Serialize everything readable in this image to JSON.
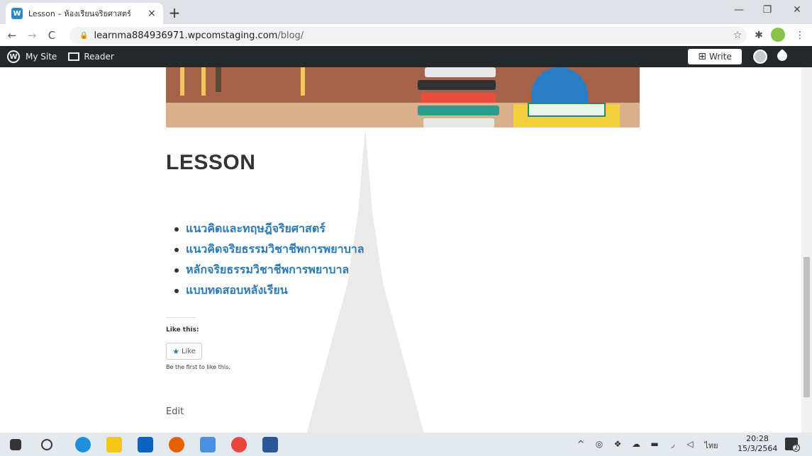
{
  "browser": {
    "tab_title": "Lesson – ห้องเรียนจริยศาสตร์",
    "favicon_letter": "W",
    "tab_close": "×",
    "new_tab": "+",
    "url_host": "learnma884936971.wpcomstaging.com",
    "url_path": "/blog/",
    "nav": {
      "back": "←",
      "forward": "→",
      "reload": "C"
    },
    "window": {
      "minimize": "—",
      "restore": "❐",
      "close": "✕"
    },
    "toolbar": {
      "bookmark": "☆",
      "extensions": "✱",
      "menu": "⋮"
    }
  },
  "wp_admin_bar": {
    "my_site": "My Site",
    "reader": "Reader",
    "write": "Write",
    "wp_logo": "W"
  },
  "post": {
    "title": "LESSON",
    "lessons": [
      "แนวคิดและทฤษฎีจริยศาสตร์",
      "แนวคิดจริยธรรมวิชาชีพการพยาบาล",
      "หลักจริยธรรมวิชาชีพการพยาบาล",
      "แบบทดสอบหลังเรียน"
    ],
    "like_heading": "Like this:",
    "like_button": "Like",
    "like_star": "★",
    "like_note": "Be the first to like this.",
    "edit_label": "Edit"
  },
  "taskbar": {
    "time": "20:28",
    "date": "15/3/2564",
    "language": "ไทย",
    "notification_count": "2",
    "tray_chevron": "^"
  },
  "colors": {
    "link": "#2b7bb9",
    "admin_bar": "#23282d",
    "banner_bg": "#a5634c"
  }
}
